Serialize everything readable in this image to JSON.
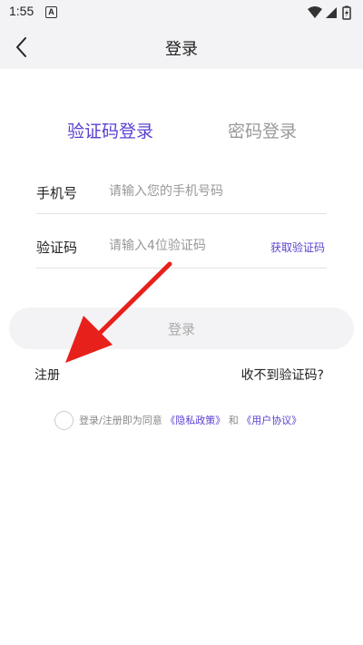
{
  "status_bar": {
    "time": "1:55",
    "notification_badge": "A"
  },
  "header": {
    "title": "登录"
  },
  "tabs": [
    {
      "label": "验证码登录",
      "active": true
    },
    {
      "label": "密码登录",
      "active": false
    }
  ],
  "form": {
    "phone": {
      "label": "手机号",
      "placeholder": "请输入您的手机号码",
      "value": ""
    },
    "code": {
      "label": "验证码",
      "placeholder": "请输入4位验证码",
      "value": "",
      "get_code_label": "获取验证码"
    }
  },
  "login_button": {
    "label": "登录"
  },
  "register_link": "注册",
  "no_code_link": "收不到验证码?",
  "agreement": {
    "prefix": "登录/注册即为同意",
    "privacy_link": "《隐私政策》",
    "connector": "和",
    "user_agreement_link": "《用户协议》",
    "checked": false
  },
  "colors": {
    "accent": "#5b3fd0",
    "annotation_arrow": "#e8201c",
    "bar_background": "#f3f3f5"
  }
}
